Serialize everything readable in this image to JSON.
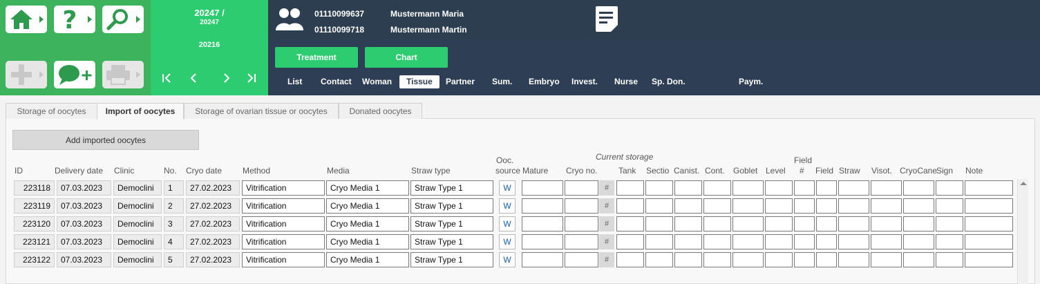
{
  "toolbar": {
    "home_icon": "home-icon",
    "help_icon": "help-icon",
    "search_icon": "search-icon",
    "add_icon": "add-icon",
    "comment_icon": "comment-add-icon",
    "print_icon": "print-icon"
  },
  "record": {
    "line1": "20247 /",
    "line2": "20247",
    "line3": "20216",
    "nav": {
      "first": "K",
      "prev": "<",
      "next": ">",
      "last": "›|"
    }
  },
  "patients": [
    {
      "id": "01110099637",
      "name": "Mustermann Maria"
    },
    {
      "id": "01110099718",
      "name": "Mustermann Martin"
    }
  ],
  "buttons": {
    "treatment": "Treatment",
    "chart": "Chart"
  },
  "nav_tabs": [
    {
      "label": "List"
    },
    {
      "label": "Contact"
    },
    {
      "label": "Woman"
    },
    {
      "label": "Tissue"
    },
    {
      "label": "Partner"
    },
    {
      "label": "Sum."
    },
    {
      "label": "Embryo"
    },
    {
      "label": "Invest."
    },
    {
      "label": "Nurse"
    },
    {
      "label": "Sp. Don."
    },
    {
      "label": "Paym."
    }
  ],
  "sub_tabs": [
    {
      "label": "Storage of oocytes"
    },
    {
      "label": "Import of oocytes"
    },
    {
      "label": "Storage of ovarian tissue or oocytes"
    },
    {
      "label": "Donated oocytes"
    }
  ],
  "add_button": "Add imported oocytes",
  "group_header": "Current storage",
  "columns": {
    "id": "ID",
    "delivery": "Delivery date",
    "clinic": "Clinic",
    "no": "No.",
    "cryo": "Cryo date",
    "method": "Method",
    "media": "Media",
    "straw_type": "Straw type",
    "ooc_source_1": "Ooc.",
    "ooc_source_2": "source",
    "mature": "Mature",
    "cryo_no": "Cryo no.",
    "tank": "Tank",
    "sectio": "Sectio",
    "canist": "Canist.",
    "cont": "Cont.",
    "goblet": "Goblet",
    "level": "Level",
    "field_no_1": "Field",
    "field_no_2": "#",
    "field": "Field",
    "straw": "Straw",
    "visot": "Visot.",
    "cryocane": "CryoCane",
    "sign": "Sign",
    "note": "Note"
  },
  "rows": [
    {
      "id": "223118",
      "delivery": "07.03.2023",
      "clinic": "Democlini",
      "no": "1",
      "cryo": "27.02.2023",
      "method": "Vitrification",
      "media": "Cryo Media 1",
      "straw_type": "Straw Type 1",
      "source": "W"
    },
    {
      "id": "223119",
      "delivery": "07.03.2023",
      "clinic": "Democlini",
      "no": "2",
      "cryo": "27.02.2023",
      "method": "Vitrification",
      "media": "Cryo Media 1",
      "straw_type": "Straw Type 1",
      "source": "W"
    },
    {
      "id": "223120",
      "delivery": "07.03.2023",
      "clinic": "Democlini",
      "no": "3",
      "cryo": "27.02.2023",
      "method": "Vitrification",
      "media": "Cryo Media 1",
      "straw_type": "Straw Type 1",
      "source": "W"
    },
    {
      "id": "223121",
      "delivery": "07.03.2023",
      "clinic": "Democlini",
      "no": "4",
      "cryo": "27.02.2023",
      "method": "Vitrification",
      "media": "Cryo Media 1",
      "straw_type": "Straw Type 1",
      "source": "W"
    },
    {
      "id": "223122",
      "delivery": "07.03.2023",
      "clinic": "Democlini",
      "no": "5",
      "cryo": "27.02.2023",
      "method": "Vitrification",
      "media": "Cryo Media 1",
      "straw_type": "Straw Type 1",
      "source": "W"
    }
  ],
  "hash_symbol": "#"
}
